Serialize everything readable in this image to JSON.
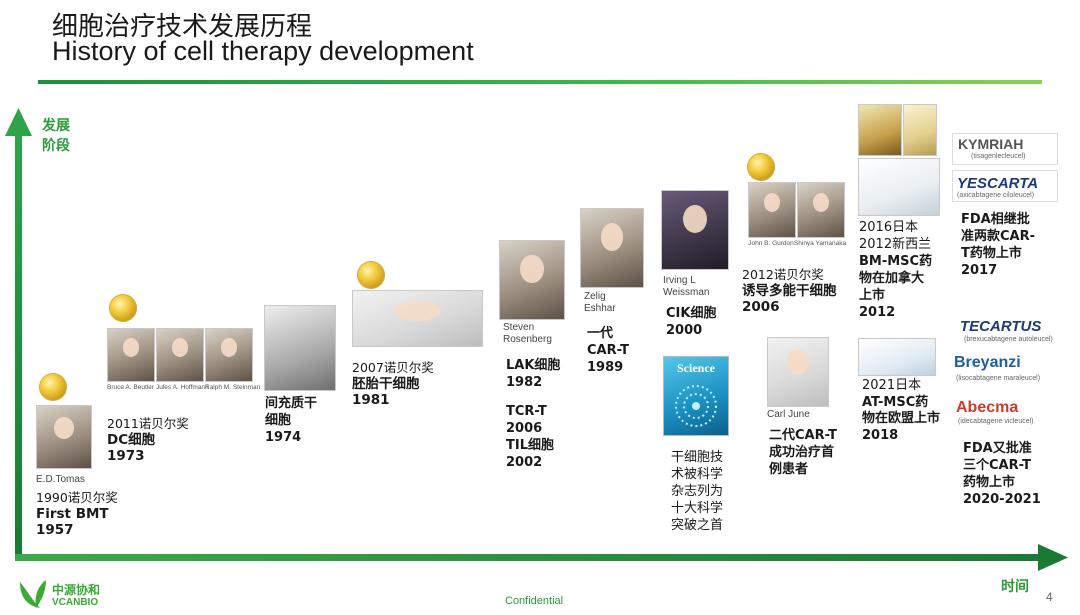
{
  "title": {
    "zh": "细胞治疗技术发展历程",
    "en": "History of cell therapy development"
  },
  "axes": {
    "y_label_1": "发展",
    "y_label_2": "阶段",
    "x_label": "时间"
  },
  "colors": {
    "accent_green": "#1f8f3a",
    "axis_green": "#1a8a3a"
  },
  "milestones": {
    "m1957": {
      "caption": "E.D.Tomas",
      "line1": "1990诺贝尔奖",
      "line2": "First BMT",
      "line3": "1957",
      "icon": "nobel-medal-icon"
    },
    "m1973": {
      "names": [
        "Bruce A. Beutler",
        "Jules A. Hoffmann",
        "Ralph M. Steinman"
      ],
      "line1": "2011诺贝尔奖",
      "line2": "DC细胞",
      "line3": "1973"
    },
    "m1974": {
      "line1": "间充质干",
      "line2": "细胞",
      "line3": "1974"
    },
    "m1981": {
      "line1": "2007诺贝尔奖",
      "line2": "胚胎干细胞",
      "line3": "1981"
    },
    "m1982": {
      "caption1": "Steven",
      "caption2": "Rosenberg",
      "line1": "LAK细胞",
      "line2": "1982",
      "line3": "TCR-T",
      "line4": "2006",
      "line5": "TIL细胞",
      "line6": "2002"
    },
    "m1989": {
      "caption1": "Zelig",
      "caption2": "Eshhar",
      "line1": "一代",
      "line2": "CAR-T",
      "line3": "1989"
    },
    "m2000": {
      "caption1": "Irving L",
      "caption2": "Weissman",
      "line1": "CIK细胞",
      "line2": "2000",
      "journal": "Science",
      "note1": "干细胞技",
      "note2": "术被科学",
      "note3": "杂志列为",
      "note4": "十大科学",
      "note5": "突破之首"
    },
    "m2006": {
      "names": [
        "John B. Gurdon",
        "Shinya Yamanaka"
      ],
      "line1": "2012诺贝尔奖",
      "line2": "诱导多能干细胞",
      "line3": "2006"
    },
    "mCarl": {
      "caption": "Carl June",
      "line1": "二代CAR-T",
      "line2": "成功治疗首",
      "line3": "例患者"
    },
    "m2012": {
      "line1": "2016日本",
      "line2": "2012新西兰",
      "line3": "BM-MSC药",
      "line4": "物在加拿大",
      "line5": "上市",
      "line6": "2012"
    },
    "m2018": {
      "line1": "2021日本",
      "line2": "AT-MSC药",
      "line3": "物在欧盟上市",
      "line4": "2018"
    },
    "m2017": {
      "brand1": "KYMRIAH",
      "brand1_sub": "(tisagenlecleucel)",
      "brand2": "YESCARTA",
      "brand2_sub": "(axicabtagene ciloleucel)",
      "line1": "FDA相继批",
      "line2": "准两款CAR-",
      "line3": "T药物上市",
      "line4": "2017"
    },
    "m2020": {
      "brand1": "TECARTUS",
      "brand1_sub": "(brexucabtagene autoleucel)",
      "brand2": "Breyanzi",
      "brand2_sub": "(lisocabtagene maraleucel)",
      "brand3": "Abecma",
      "brand3_sub": "(idecabtagene vicleucel)",
      "line1": "FDA又批准",
      "line2": "三个CAR-T",
      "line3": "药物上市",
      "line4": "2020-2021"
    }
  },
  "footer": {
    "logo_zh": "中源协和",
    "logo_en": "VCANBIO",
    "confidential": "Confidential",
    "page_number": "4"
  }
}
